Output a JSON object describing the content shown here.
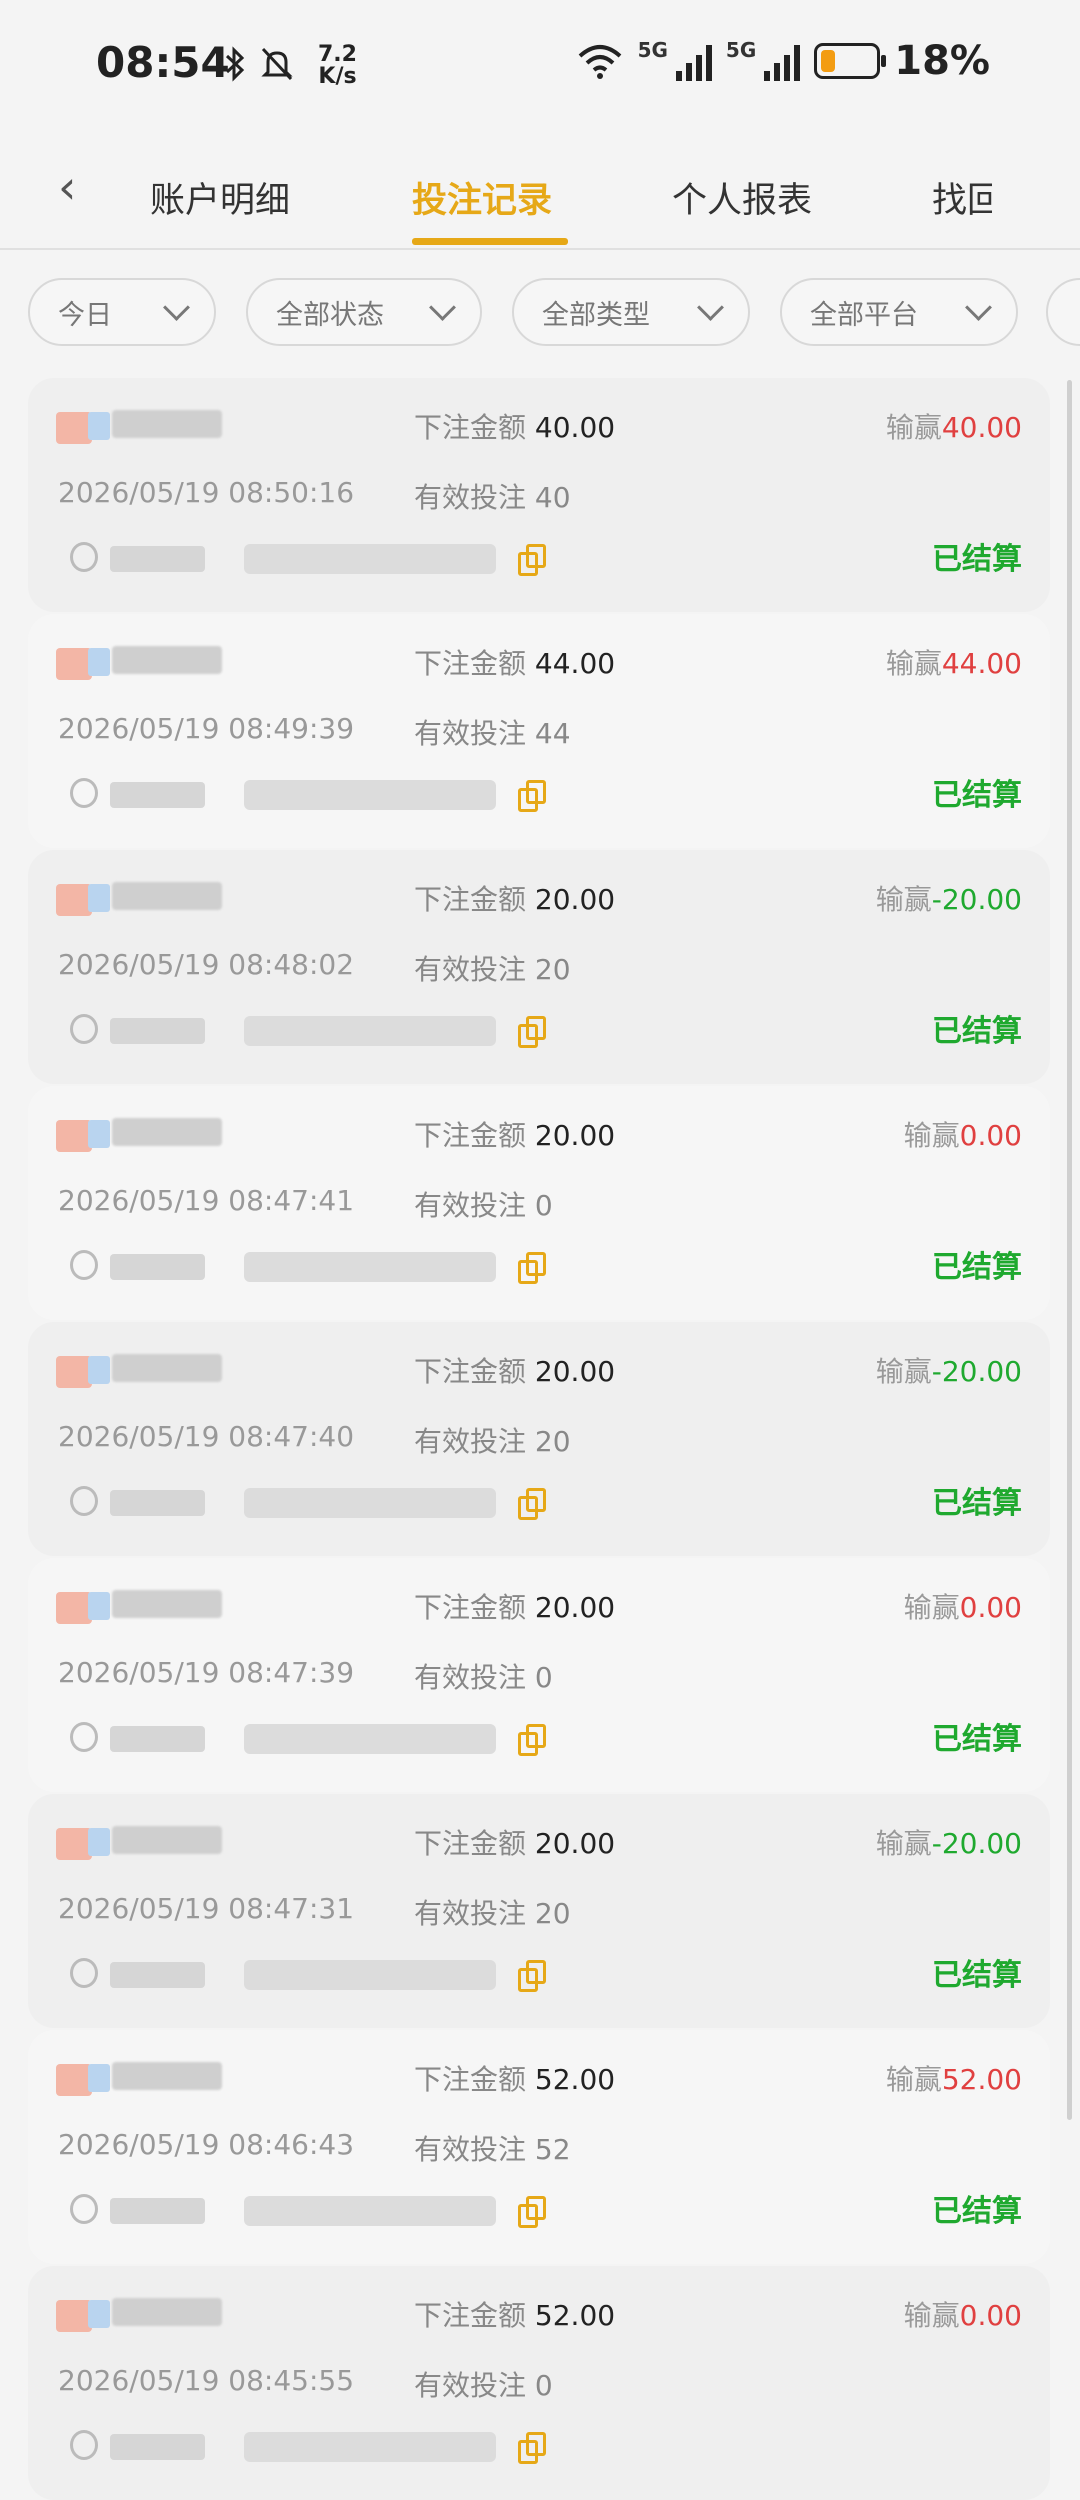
{
  "status_bar": {
    "time": "08:54",
    "net_speed_value": "7.2",
    "net_speed_unit": "K/s",
    "battery_pct": "18%",
    "net_type_1": "5G",
    "net_type_2": "5G"
  },
  "tabs": [
    {
      "label": "账户明细",
      "active": false
    },
    {
      "label": "投注记录",
      "active": true
    },
    {
      "label": "个人报表",
      "active": false
    },
    {
      "label": "找回",
      "active": false
    }
  ],
  "filters": [
    "今日",
    "全部状态",
    "全部类型",
    "全部平台"
  ],
  "labels": {
    "bet_amount": "下注金额",
    "valid_bet": "有效投注",
    "win_lose": "输赢"
  },
  "records": [
    {
      "bet": "40.00",
      "date": "2026/05/19 08:50:16",
      "valid": "40",
      "winlose": "40.00",
      "sign": "pos",
      "status": "已结算"
    },
    {
      "bet": "44.00",
      "date": "2026/05/19 08:49:39",
      "valid": "44",
      "winlose": "44.00",
      "sign": "pos",
      "status": "已结算"
    },
    {
      "bet": "20.00",
      "date": "2026/05/19 08:48:02",
      "valid": "20",
      "winlose": "-20.00",
      "sign": "neg",
      "status": "已结算"
    },
    {
      "bet": "20.00",
      "date": "2026/05/19 08:47:41",
      "valid": "0",
      "winlose": "0.00",
      "sign": "zero",
      "status": "已结算"
    },
    {
      "bet": "20.00",
      "date": "2026/05/19 08:47:40",
      "valid": "20",
      "winlose": "-20.00",
      "sign": "neg",
      "status": "已结算"
    },
    {
      "bet": "20.00",
      "date": "2026/05/19 08:47:39",
      "valid": "0",
      "winlose": "0.00",
      "sign": "zero",
      "status": "已结算"
    },
    {
      "bet": "20.00",
      "date": "2026/05/19 08:47:31",
      "valid": "20",
      "winlose": "-20.00",
      "sign": "neg",
      "status": "已结算"
    },
    {
      "bet": "52.00",
      "date": "2026/05/19 08:46:43",
      "valid": "52",
      "winlose": "52.00",
      "sign": "pos",
      "status": "已结算"
    },
    {
      "bet": "52.00",
      "date": "2026/05/19 08:45:55",
      "valid": "0",
      "winlose": "0.00",
      "sign": "zero",
      "status": ""
    }
  ],
  "colors": {
    "accent": "#e6a817",
    "win": "#e04040",
    "lose": "#1fa92f",
    "settled": "#1fa92f"
  }
}
